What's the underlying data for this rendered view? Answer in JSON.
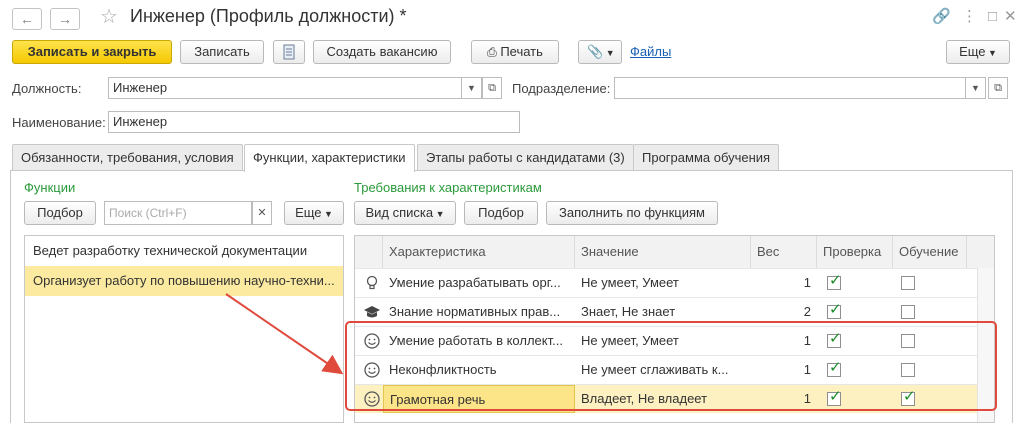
{
  "window": {
    "title": "Инженер (Профиль должности) *"
  },
  "toolbar": {
    "save_close": "Записать и закрыть",
    "save": "Записать",
    "create_vacancy": "Создать вакансию",
    "print": "Печать",
    "files": "Файлы",
    "more": "Еще"
  },
  "form": {
    "position_label": "Должность:",
    "position_value": "Инженер",
    "department_label": "Подразделение:",
    "department_value": "",
    "name_label": "Наименование:",
    "name_value": "Инженер"
  },
  "tabs": [
    {
      "label": "Обязанности, требования, условия"
    },
    {
      "label": "Функции, характеристики"
    },
    {
      "label": "Этапы работы с кандидатами (3)"
    },
    {
      "label": "Программа обучения"
    }
  ],
  "functions": {
    "title": "Функции",
    "select_button": "Подбор",
    "search_placeholder": "Поиск (Ctrl+F)",
    "more": "Еще",
    "items": [
      {
        "label": "Ведет разработку технической документации",
        "selected": false
      },
      {
        "label": "Организует работу по повышению научно-техни...",
        "selected": true
      }
    ]
  },
  "requirements": {
    "title": "Требования к характеристикам",
    "view_list": "Вид списка",
    "select_button": "Подбор",
    "fill_button": "Заполнить по функциям",
    "columns": {
      "characteristic": "Характеристика",
      "value": "Значение",
      "weight": "Вес",
      "check": "Проверка",
      "training": "Обучение"
    },
    "rows": [
      {
        "icon": "bulb-icon",
        "characteristic": "Умение разрабатывать орг...",
        "value": "Не умеет, Умеет",
        "weight": "1",
        "check": true,
        "training": false
      },
      {
        "icon": "graduation-cap-icon",
        "characteristic": "Знание нормативных прав...",
        "value": "Знает, Не знает",
        "weight": "2",
        "check": true,
        "training": false
      },
      {
        "icon": "smiley-icon",
        "characteristic": "Умение работать в коллект...",
        "value": "Не умеет, Умеет",
        "weight": "1",
        "check": true,
        "training": false
      },
      {
        "icon": "smiley-icon",
        "characteristic": "Неконфликтность",
        "value": "Не умеет сглаживать к...",
        "weight": "1",
        "check": true,
        "training": false
      },
      {
        "icon": "smiley-icon",
        "characteristic": "Грамотная речь",
        "value": "Владеет, Не владеет",
        "weight": "1",
        "check": true,
        "training": true
      }
    ]
  },
  "colors": {
    "primary_button": "#f5c800",
    "section_title": "#2a9a3a",
    "selection": "#fbeaa0",
    "annotation": "#e04a3c",
    "check": "#1d8a2a"
  }
}
